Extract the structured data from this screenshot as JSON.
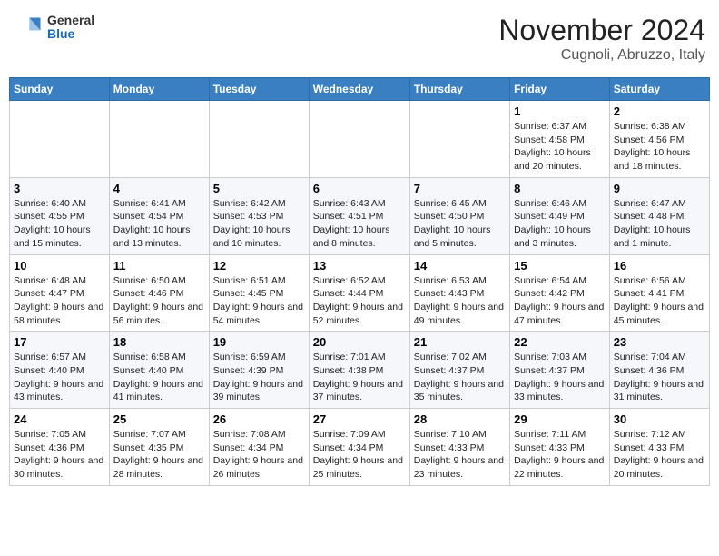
{
  "header": {
    "logo": {
      "general": "General",
      "blue": "Blue"
    },
    "title": "November 2024",
    "location": "Cugnoli, Abruzzo, Italy"
  },
  "calendar": {
    "days_of_week": [
      "Sunday",
      "Monday",
      "Tuesday",
      "Wednesday",
      "Thursday",
      "Friday",
      "Saturday"
    ],
    "weeks": [
      [
        {
          "day": "",
          "info": ""
        },
        {
          "day": "",
          "info": ""
        },
        {
          "day": "",
          "info": ""
        },
        {
          "day": "",
          "info": ""
        },
        {
          "day": "",
          "info": ""
        },
        {
          "day": "1",
          "info": "Sunrise: 6:37 AM\nSunset: 4:58 PM\nDaylight: 10 hours and 20 minutes."
        },
        {
          "day": "2",
          "info": "Sunrise: 6:38 AM\nSunset: 4:56 PM\nDaylight: 10 hours and 18 minutes."
        }
      ],
      [
        {
          "day": "3",
          "info": "Sunrise: 6:40 AM\nSunset: 4:55 PM\nDaylight: 10 hours and 15 minutes."
        },
        {
          "day": "4",
          "info": "Sunrise: 6:41 AM\nSunset: 4:54 PM\nDaylight: 10 hours and 13 minutes."
        },
        {
          "day": "5",
          "info": "Sunrise: 6:42 AM\nSunset: 4:53 PM\nDaylight: 10 hours and 10 minutes."
        },
        {
          "day": "6",
          "info": "Sunrise: 6:43 AM\nSunset: 4:51 PM\nDaylight: 10 hours and 8 minutes."
        },
        {
          "day": "7",
          "info": "Sunrise: 6:45 AM\nSunset: 4:50 PM\nDaylight: 10 hours and 5 minutes."
        },
        {
          "day": "8",
          "info": "Sunrise: 6:46 AM\nSunset: 4:49 PM\nDaylight: 10 hours and 3 minutes."
        },
        {
          "day": "9",
          "info": "Sunrise: 6:47 AM\nSunset: 4:48 PM\nDaylight: 10 hours and 1 minute."
        }
      ],
      [
        {
          "day": "10",
          "info": "Sunrise: 6:48 AM\nSunset: 4:47 PM\nDaylight: 9 hours and 58 minutes."
        },
        {
          "day": "11",
          "info": "Sunrise: 6:50 AM\nSunset: 4:46 PM\nDaylight: 9 hours and 56 minutes."
        },
        {
          "day": "12",
          "info": "Sunrise: 6:51 AM\nSunset: 4:45 PM\nDaylight: 9 hours and 54 minutes."
        },
        {
          "day": "13",
          "info": "Sunrise: 6:52 AM\nSunset: 4:44 PM\nDaylight: 9 hours and 52 minutes."
        },
        {
          "day": "14",
          "info": "Sunrise: 6:53 AM\nSunset: 4:43 PM\nDaylight: 9 hours and 49 minutes."
        },
        {
          "day": "15",
          "info": "Sunrise: 6:54 AM\nSunset: 4:42 PM\nDaylight: 9 hours and 47 minutes."
        },
        {
          "day": "16",
          "info": "Sunrise: 6:56 AM\nSunset: 4:41 PM\nDaylight: 9 hours and 45 minutes."
        }
      ],
      [
        {
          "day": "17",
          "info": "Sunrise: 6:57 AM\nSunset: 4:40 PM\nDaylight: 9 hours and 43 minutes."
        },
        {
          "day": "18",
          "info": "Sunrise: 6:58 AM\nSunset: 4:40 PM\nDaylight: 9 hours and 41 minutes."
        },
        {
          "day": "19",
          "info": "Sunrise: 6:59 AM\nSunset: 4:39 PM\nDaylight: 9 hours and 39 minutes."
        },
        {
          "day": "20",
          "info": "Sunrise: 7:01 AM\nSunset: 4:38 PM\nDaylight: 9 hours and 37 minutes."
        },
        {
          "day": "21",
          "info": "Sunrise: 7:02 AM\nSunset: 4:37 PM\nDaylight: 9 hours and 35 minutes."
        },
        {
          "day": "22",
          "info": "Sunrise: 7:03 AM\nSunset: 4:37 PM\nDaylight: 9 hours and 33 minutes."
        },
        {
          "day": "23",
          "info": "Sunrise: 7:04 AM\nSunset: 4:36 PM\nDaylight: 9 hours and 31 minutes."
        }
      ],
      [
        {
          "day": "24",
          "info": "Sunrise: 7:05 AM\nSunset: 4:36 PM\nDaylight: 9 hours and 30 minutes."
        },
        {
          "day": "25",
          "info": "Sunrise: 7:07 AM\nSunset: 4:35 PM\nDaylight: 9 hours and 28 minutes."
        },
        {
          "day": "26",
          "info": "Sunrise: 7:08 AM\nSunset: 4:34 PM\nDaylight: 9 hours and 26 minutes."
        },
        {
          "day": "27",
          "info": "Sunrise: 7:09 AM\nSunset: 4:34 PM\nDaylight: 9 hours and 25 minutes."
        },
        {
          "day": "28",
          "info": "Sunrise: 7:10 AM\nSunset: 4:33 PM\nDaylight: 9 hours and 23 minutes."
        },
        {
          "day": "29",
          "info": "Sunrise: 7:11 AM\nSunset: 4:33 PM\nDaylight: 9 hours and 22 minutes."
        },
        {
          "day": "30",
          "info": "Sunrise: 7:12 AM\nSunset: 4:33 PM\nDaylight: 9 hours and 20 minutes."
        }
      ]
    ]
  }
}
